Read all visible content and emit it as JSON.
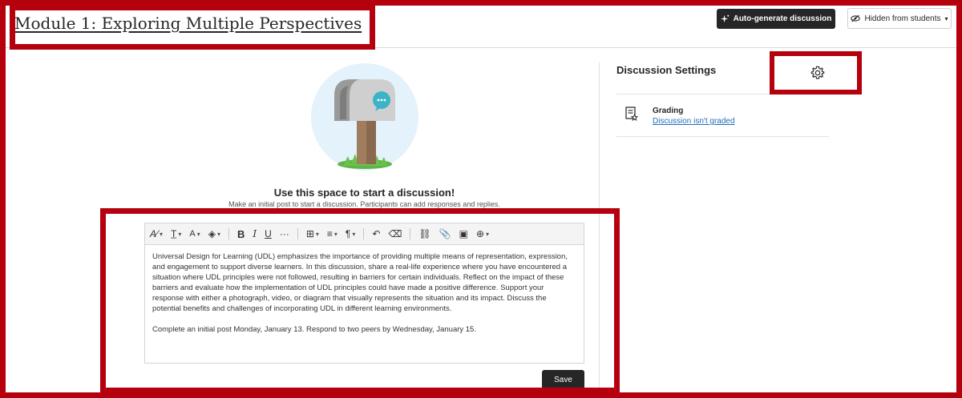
{
  "header": {
    "title": "Module 1: Exploring Multiple Perspectives",
    "auto_generate_label": "Auto-generate discussion",
    "visibility_label": "Hidden from students"
  },
  "sidebar": {
    "title": "Discussion Settings",
    "grading_label": "Grading",
    "grading_value": "Discussion isn't graded"
  },
  "main": {
    "heading": "Use this space to start a discussion!",
    "subheading": "Make an initial post to start a discussion. Participants can add responses and replies.",
    "prompt_paragraph_1": "Universal Design for Learning (UDL) emphasizes the importance of providing multiple means of representation, expression, and engagement to support diverse learners. In this discussion, share a real-life experience where you have encountered a situation where UDL principles were not followed, resulting in barriers for certain individuals. Reflect on the impact of these barriers and evaluate how the implementation of UDL principles could have made a positive difference. Support your response with either a photograph, video, or diagram that visually represents the situation and its impact. Discuss the potential benefits and challenges of incorporating UDL in different learning environments.",
    "prompt_paragraph_2": "Complete an initial post Monday, January 13. Respond to two peers by Wednesday, January 15.",
    "save_label": "Save"
  },
  "toolbar": {
    "bold": "B",
    "italic": "I",
    "underline": "U",
    "more": "···",
    "paragraph": "¶",
    "insert": "⊕"
  },
  "colors": {
    "highlight_frame": "#b5000d",
    "dark_button": "#262626",
    "link": "#1f6fb5"
  }
}
